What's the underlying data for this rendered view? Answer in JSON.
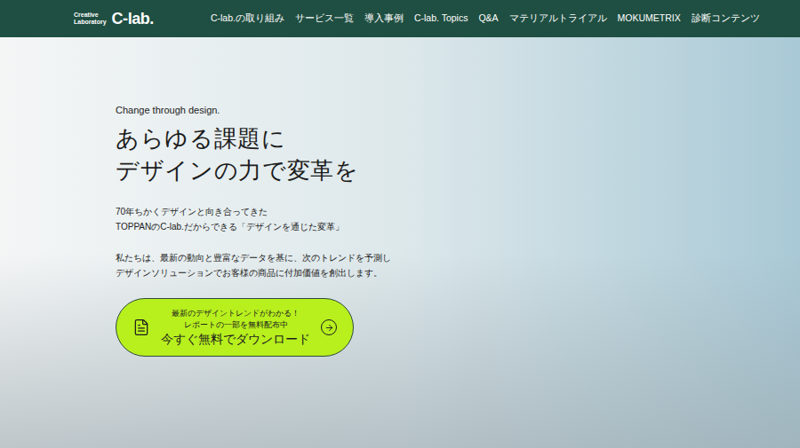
{
  "header": {
    "logo": {
      "small_lines": [
        "Creative",
        "Laboratory"
      ],
      "mark": "C-lab."
    },
    "nav": [
      "C-lab.の取り組み",
      "サービス一覧",
      "導入事例",
      "C-lab. Topics",
      "Q&A",
      "マテリアルトライアル",
      "MOKUMETRIX",
      "診断コンテンツ"
    ]
  },
  "hero": {
    "tagline": "Change through design.",
    "heading": [
      "あらゆる課題に",
      "デザインの力で変革を"
    ],
    "paragraphs": [
      [
        "70年ちかくデザインと向き合ってきた",
        "TOPPANのC-lab.だからできる「デザインを通じた変革」"
      ],
      [
        "私たちは、最新の動向と豊富なデータを基に、次のトレンドを予測し",
        "デザインソリューションでお客様の商品に付加価値を創出します。"
      ]
    ],
    "cta": {
      "eyebrow": "最新のデザイントレンドがわかる！",
      "sub": "レポートの一部を無料配布中",
      "label": "今すぐ無料でダウンロード"
    }
  }
}
